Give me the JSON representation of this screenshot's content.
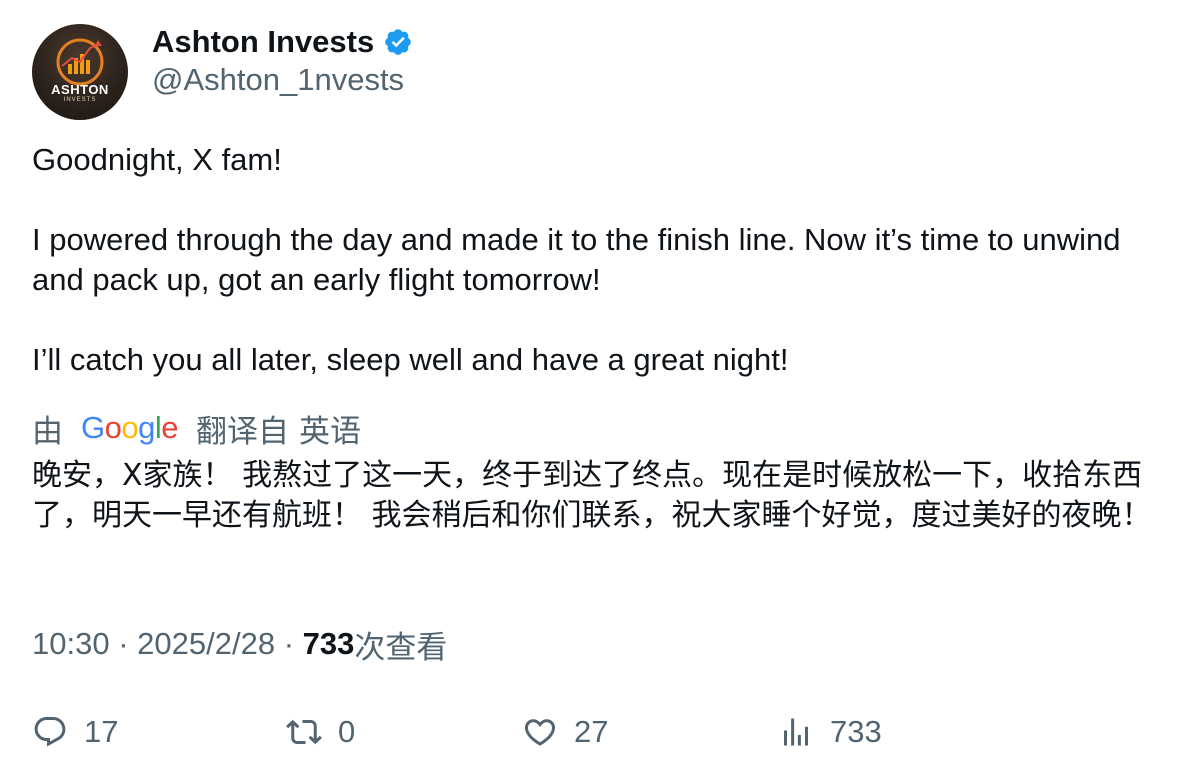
{
  "author": {
    "display_name": "Ashton Invests",
    "handle": "@Ashton_1nvests",
    "verified": true,
    "avatar_text": "ASHTON",
    "avatar_subtext": "INVESTS"
  },
  "tweet": {
    "paragraphs": [
      "Goodnight, X fam!",
      "I powered through the day and made it to the finish line. Now it’s time to unwind and pack up, got an early flight tomorrow!",
      "I’ll catch you all later, sleep well and have a great night!"
    ]
  },
  "translation": {
    "prefix": "由",
    "provider": "Google",
    "suffix_a": "翻译自",
    "suffix_b": "英语",
    "text": "晚安，X家族！ 我熬过了这一天，终于到达了终点。现在是时候放松一下，收拾东西了，明天一早还有航班！ 我会稍后和你们联系，祝大家睡个好觉，度过美好的夜晚！"
  },
  "meta": {
    "time": "10:30",
    "separator": "·",
    "date": "2025/2/28",
    "views_count": "733",
    "views_label": "次查看"
  },
  "actions": {
    "reply_count": "17",
    "retweet_count": "0",
    "like_count": "27",
    "views_count": "733"
  },
  "colors": {
    "text_primary": "#0f1419",
    "text_secondary": "#536471",
    "verified_blue": "#1d9bf0"
  },
  "icons": {
    "verified": "verified-badge-icon",
    "reply": "reply-icon",
    "retweet": "retweet-icon",
    "like": "heart-icon",
    "views": "analytics-icon"
  }
}
